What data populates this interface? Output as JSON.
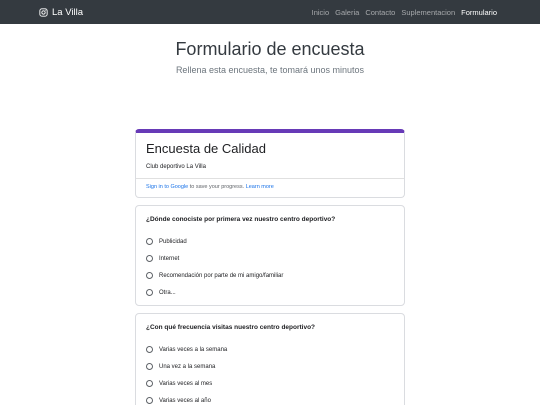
{
  "navbar": {
    "brand": "La Villa",
    "items": [
      {
        "label": "Inicio",
        "active": false
      },
      {
        "label": "Galeria",
        "active": false
      },
      {
        "label": "Contacto",
        "active": false
      },
      {
        "label": "Suplementacion",
        "active": false
      },
      {
        "label": "Formulario",
        "active": true
      }
    ]
  },
  "header": {
    "title": "Formulario de encuesta",
    "subtitle": "Rellena esta encuesta, te tomará unos minutos"
  },
  "form": {
    "title": "Encuesta de Calidad",
    "description": "Club deportivo La Villa",
    "signin_link": "Sign in to Google",
    "signin_text": " to save your progress. ",
    "learn_more": "Learn more"
  },
  "questions": [
    {
      "title": "¿Dónde conociste por primera vez nuestro centro deportivo?",
      "options": [
        "Publicidad",
        "Internet",
        "Recomendación por parte de mi amigo/familiar",
        "Otra..."
      ]
    },
    {
      "title": "¿Con qué frecuencia visitas nuestro centro deportivo?",
      "options": [
        "Varias veces a la semana",
        "Una vez a la semana",
        "Varias veces al mes",
        "Varias veces al año"
      ]
    }
  ]
}
